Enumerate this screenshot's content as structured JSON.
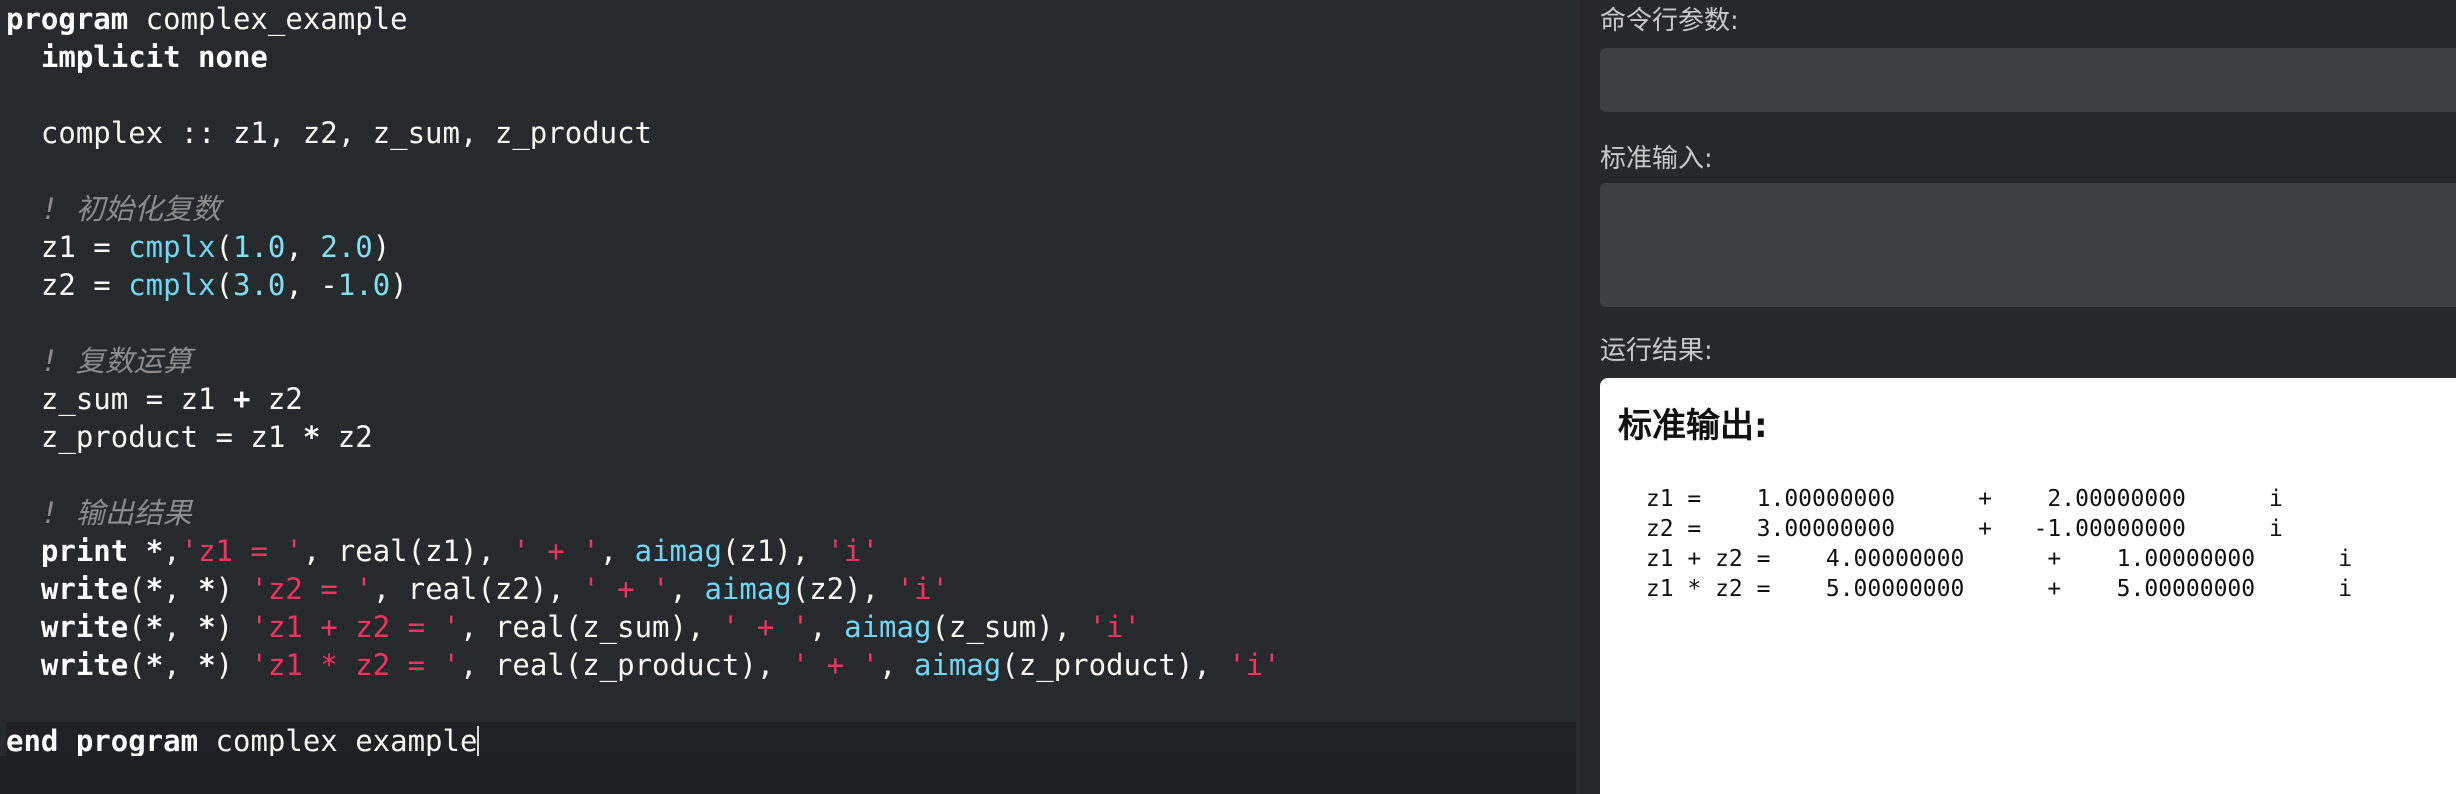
{
  "editor": {
    "lines": [
      [
        {
          "t": "program",
          "c": "kw"
        },
        {
          "t": " complex_example"
        }
      ],
      [
        {
          "t": "  "
        },
        {
          "t": "implicit none",
          "c": "kw"
        }
      ],
      [],
      [
        {
          "t": "  complex :: z1, z2, z_sum, z_product"
        }
      ],
      [],
      [
        {
          "t": "  "
        },
        {
          "t": "! 初始化复数",
          "c": "cmt"
        }
      ],
      [
        {
          "t": "  z1 = "
        },
        {
          "t": "cmplx",
          "c": "fn"
        },
        {
          "t": "("
        },
        {
          "t": "1.0",
          "c": "num"
        },
        {
          "t": ", "
        },
        {
          "t": "2.0",
          "c": "num"
        },
        {
          "t": ")"
        }
      ],
      [
        {
          "t": "  z2 = "
        },
        {
          "t": "cmplx",
          "c": "fn"
        },
        {
          "t": "("
        },
        {
          "t": "3.0",
          "c": "num"
        },
        {
          "t": ", -"
        },
        {
          "t": "1.0",
          "c": "num"
        },
        {
          "t": ")"
        }
      ],
      [],
      [
        {
          "t": "  "
        },
        {
          "t": "! 复数运算",
          "c": "cmt"
        }
      ],
      [
        {
          "t": "  z_sum = z1 "
        },
        {
          "t": "+",
          "c": "kw"
        },
        {
          "t": " z2"
        }
      ],
      [
        {
          "t": "  z_product = z1 "
        },
        {
          "t": "*",
          "c": "kw"
        },
        {
          "t": " z2"
        }
      ],
      [],
      [
        {
          "t": "  "
        },
        {
          "t": "! 输出结果",
          "c": "cmt"
        }
      ],
      [
        {
          "t": "  "
        },
        {
          "t": "print",
          "c": "kw"
        },
        {
          "t": " "
        },
        {
          "t": "*",
          "c": "kw"
        },
        {
          "t": ","
        },
        {
          "t": "'z1 = '",
          "c": "str"
        },
        {
          "t": ", real(z1), "
        },
        {
          "t": "' + '",
          "c": "str"
        },
        {
          "t": ", "
        },
        {
          "t": "aimag",
          "c": "fn"
        },
        {
          "t": "(z1), "
        },
        {
          "t": "'i'",
          "c": "str"
        }
      ],
      [
        {
          "t": "  "
        },
        {
          "t": "write",
          "c": "kw"
        },
        {
          "t": "("
        },
        {
          "t": "*",
          "c": "kw"
        },
        {
          "t": ", "
        },
        {
          "t": "*",
          "c": "kw"
        },
        {
          "t": ") "
        },
        {
          "t": "'z2 = '",
          "c": "str"
        },
        {
          "t": ", real(z2), "
        },
        {
          "t": "' + '",
          "c": "str"
        },
        {
          "t": ", "
        },
        {
          "t": "aimag",
          "c": "fn"
        },
        {
          "t": "(z2), "
        },
        {
          "t": "'i'",
          "c": "str"
        }
      ],
      [
        {
          "t": "  "
        },
        {
          "t": "write",
          "c": "kw"
        },
        {
          "t": "("
        },
        {
          "t": "*",
          "c": "kw"
        },
        {
          "t": ", "
        },
        {
          "t": "*",
          "c": "kw"
        },
        {
          "t": ") "
        },
        {
          "t": "'z1 + z2 = '",
          "c": "str"
        },
        {
          "t": ", real(z_sum), "
        },
        {
          "t": "' + '",
          "c": "str"
        },
        {
          "t": ", "
        },
        {
          "t": "aimag",
          "c": "fn"
        },
        {
          "t": "(z_sum), "
        },
        {
          "t": "'i'",
          "c": "str"
        }
      ],
      [
        {
          "t": "  "
        },
        {
          "t": "write",
          "c": "kw"
        },
        {
          "t": "("
        },
        {
          "t": "*",
          "c": "kw"
        },
        {
          "t": ", "
        },
        {
          "t": "*",
          "c": "kw"
        },
        {
          "t": ") "
        },
        {
          "t": "'z1 * z2 = '",
          "c": "str"
        },
        {
          "t": ", real(z_product), "
        },
        {
          "t": "' + '",
          "c": "str"
        },
        {
          "t": ", "
        },
        {
          "t": "aimag",
          "c": "fn"
        },
        {
          "t": "(z_product), "
        },
        {
          "t": "'i'",
          "c": "str"
        }
      ],
      [],
      [
        {
          "t": "end program",
          "c": "kw"
        },
        {
          "t": " complex_example"
        }
      ]
    ]
  },
  "panel": {
    "args_label": "命令行参数:",
    "args_value": "",
    "stdin_label": "标准输入:",
    "stdin_value": "",
    "result_label": "运行结果:",
    "output_title": "标准输出:",
    "output_lines": [
      " z1 =    1.00000000      +    2.00000000      i",
      " z2 =    3.00000000      +   -1.00000000      i",
      " z1 + z2 =    4.00000000      +    1.00000000      i",
      " z1 * z2 =    5.00000000      +    5.00000000      i"
    ]
  },
  "colors": {
    "keyword": "#ffffff",
    "function": "#6fd6f4",
    "number": "#7ee0f0",
    "string": "#f2325f",
    "comment": "#8c8c8c"
  }
}
